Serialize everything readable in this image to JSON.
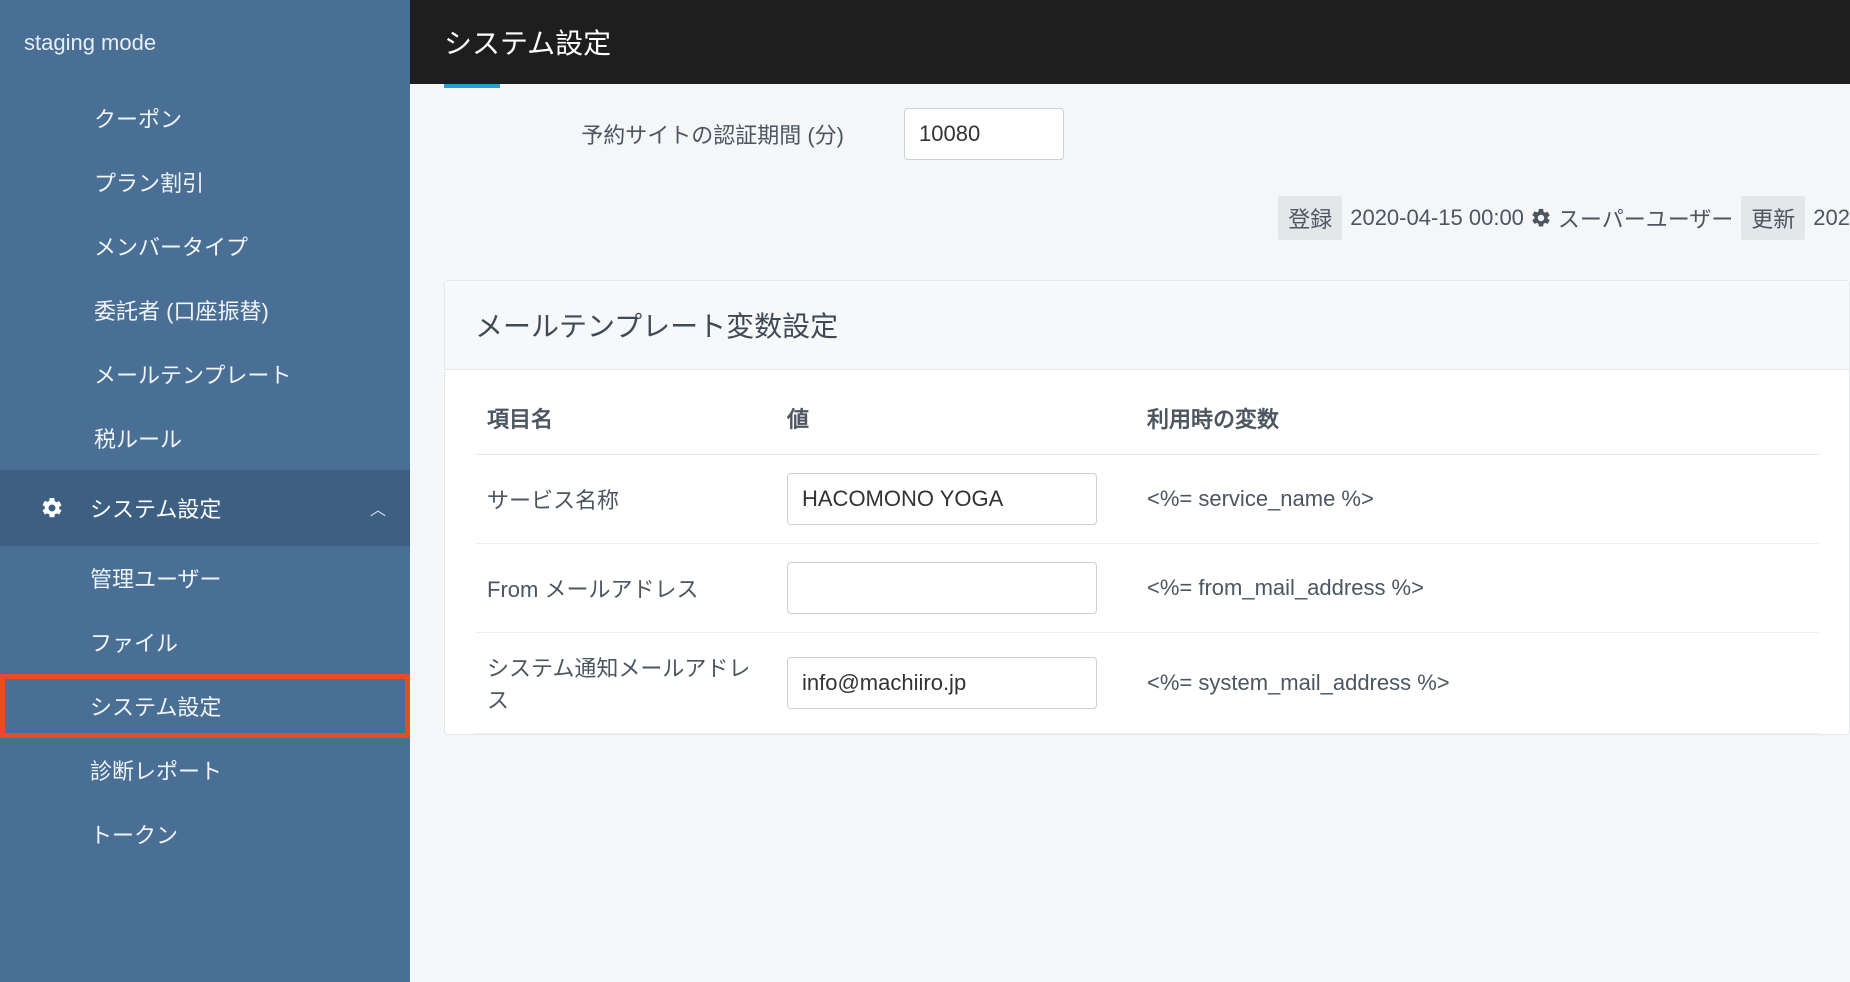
{
  "sidebar": {
    "brand": "staging mode",
    "items_top": [
      "クーポン",
      "プラン割引",
      "メンバータイプ",
      "委託者 (口座振替)",
      "メールテンプレート",
      "税ルール"
    ],
    "section": {
      "label": "システム設定"
    },
    "subitems": [
      {
        "label": "管理ユーザー",
        "highlight": false
      },
      {
        "label": "ファイル",
        "highlight": false
      },
      {
        "label": "システム設定",
        "highlight": true
      },
      {
        "label": "診断レポート",
        "highlight": false
      },
      {
        "label": "トークン",
        "highlight": false
      }
    ]
  },
  "title": "システム設定",
  "authRow": {
    "label": "予約サイトの認証期間 (分)",
    "value": "10080"
  },
  "audit": {
    "createdBadge": "登録",
    "createdAt": "2020-04-15 00:00",
    "createdBy": "スーパーユーザー",
    "updatedBadge": "更新",
    "updatedAt": "202"
  },
  "card": {
    "heading": "メールテンプレート変数設定",
    "headers": {
      "name": "項目名",
      "value": "値",
      "variable": "利用時の変数"
    },
    "rows": [
      {
        "name": "サービス名称",
        "value": "HACOMONO YOGA",
        "variable": "<%= service_name %>"
      },
      {
        "name": "From メールアドレス",
        "value": "",
        "variable": "<%= from_mail_address %>"
      },
      {
        "name": "システム通知メールアドレス",
        "value": "info@machiiro.jp",
        "variable": "<%= system_mail_address %>"
      }
    ]
  }
}
